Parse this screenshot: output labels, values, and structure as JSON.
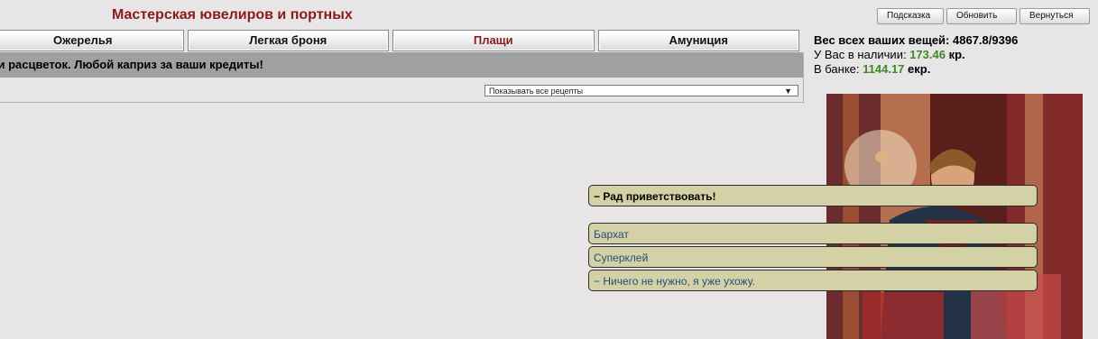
{
  "header": {
    "title": "Мастерская ювелиров и портных",
    "buttons": {
      "hint": "Подсказка",
      "refresh": "Обновить",
      "back": "Вернуться"
    }
  },
  "tabs": [
    {
      "label": "Ожерелья",
      "active": false
    },
    {
      "label": "Легкая броня",
      "active": false
    },
    {
      "label": "Плащи",
      "active": true
    },
    {
      "label": "Амуниция",
      "active": false
    }
  ],
  "shop": {
    "slogan": "ров и расцветок. Любой каприз за ваши кредиты!",
    "recipe_filter": {
      "selected": "Показывать все рецепты"
    }
  },
  "stats": {
    "weight_label": "Вес всех ваших вещей:",
    "weight_value": "4867.8/9396",
    "cash_label": "У Вас в наличии:",
    "cash_value": "173.46",
    "cash_unit": "кр.",
    "bank_label": "В банке:",
    "bank_value": "1144.17",
    "bank_unit": "екр."
  },
  "dialog": {
    "greeting": "− Рад приветствовать!",
    "options": [
      "Бархат",
      "Суперклей",
      "− Ничего не нужно, я уже ухожу."
    ]
  },
  "colors": {
    "title": "#8b1a1a",
    "money": "#3b8a25",
    "dialog_bg": "#d4d1a7",
    "dialog_text": "#234f7a"
  }
}
